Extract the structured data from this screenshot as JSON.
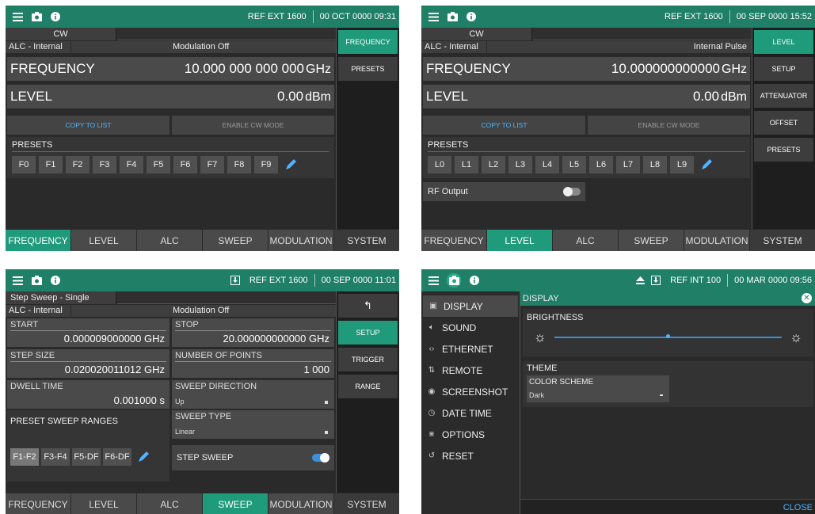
{
  "colors": {
    "accent": "#1f9a7b",
    "topbar": "#1f7f67",
    "link": "#4fb3ff"
  },
  "icons": [
    "menu-icon",
    "camera-icon",
    "info-icon",
    "pencil-icon",
    "back-arrow-icon",
    "ext-ref-icon",
    "eject-icon",
    "sun-icon",
    "close-icon"
  ],
  "tabs": [
    "FREQUENCY",
    "LEVEL",
    "ALC",
    "SWEEP",
    "MODULATION",
    "SYSTEM"
  ],
  "s1": {
    "ref": "REF EXT 1600",
    "time": "00 OCT 0000 09:31",
    "mode": "CW",
    "alc": "ALC - Internal",
    "modulation": "Modulation Off",
    "freq_label": "FREQUENCY",
    "freq_value": "10.000 000 000 000",
    "freq_unit": "GHz",
    "level_label": "LEVEL",
    "level_value": "0.00",
    "level_unit": "dBm",
    "copy_to_list": "COPY TO LIST",
    "enable_cw": "ENABLE CW MODE",
    "presets_label": "PRESETS",
    "presets": [
      "F0",
      "F1",
      "F2",
      "F3",
      "F4",
      "F5",
      "F6",
      "F7",
      "F8",
      "F9"
    ],
    "side": [
      "FREQUENCY",
      "PRESETS"
    ]
  },
  "s2": {
    "ref": "REF EXT 1600",
    "time": "00 SEP 0000 15:52",
    "mode": "CW",
    "alc": "ALC - Internal",
    "modulation": "Internal Pulse",
    "freq_label": "FREQUENCY",
    "freq_value": "10.000000000000",
    "freq_unit": "GHz",
    "level_label": "LEVEL",
    "level_value": "0.00",
    "level_unit": "dBm",
    "copy_to_list": "COPY TO LIST",
    "enable_cw": "ENABLE CW MODE",
    "presets_label": "PRESETS",
    "presets": [
      "L0",
      "L1",
      "L2",
      "L3",
      "L4",
      "L5",
      "L6",
      "L7",
      "L8",
      "L9"
    ],
    "rf_output": "RF Output",
    "side": [
      "LEVEL",
      "SETUP",
      "ATTENUATOR",
      "OFFSET",
      "PRESETS"
    ]
  },
  "s3": {
    "ref": "REF EXT 1600",
    "time": "00 SEP 0000 11:01",
    "mode": "Step Sweep - Single",
    "alc": "ALC - Internal",
    "modulation": "Modulation Off",
    "start_label": "START",
    "start_value": "0.000009000000 GHz",
    "stop_label": "STOP",
    "stop_value": "20.000000000000 GHz",
    "step_label": "STEP SIZE",
    "step_value": "0.020020011012 GHz",
    "points_label": "NUMBER OF POINTS",
    "points_value": "1 000",
    "dwell_label": "DWELL TIME",
    "dwell_value": "0.001000 s",
    "dir_label": "SWEEP DIRECTION",
    "dir_value": "Up",
    "psr_label": "PRESET SWEEP RANGES",
    "type_label": "SWEEP TYPE",
    "type_value": "Linear",
    "step_sweep": "STEP SWEEP",
    "ranges": [
      "F1-F2",
      "F3-F4",
      "F5-DF",
      "F6-DF"
    ],
    "side": [
      "SETUP",
      "TRIGGER",
      "RANGE"
    ]
  },
  "s4": {
    "ref": "REF INT 100",
    "time": "00 MAR 0000 09:56",
    "menu": [
      {
        "label": "DISPLAY",
        "icon": "display-icon"
      },
      {
        "label": "SOUND",
        "icon": "sound-icon"
      },
      {
        "label": "ETHERNET",
        "icon": "ethernet-icon"
      },
      {
        "label": "REMOTE",
        "icon": "remote-icon"
      },
      {
        "label": "SCREENSHOT",
        "icon": "camera-icon"
      },
      {
        "label": "DATE TIME",
        "icon": "clock-icon"
      },
      {
        "label": "OPTIONS",
        "icon": "options-icon"
      },
      {
        "label": "RESET",
        "icon": "reset-icon"
      }
    ],
    "panel_title": "DISPLAY",
    "brightness_label": "BRIGHTNESS",
    "brightness": 0.5,
    "theme_label": "THEME",
    "color_scheme_label": "COLOR SCHEME",
    "color_scheme_value": "Dark",
    "close": "CLOSE"
  }
}
